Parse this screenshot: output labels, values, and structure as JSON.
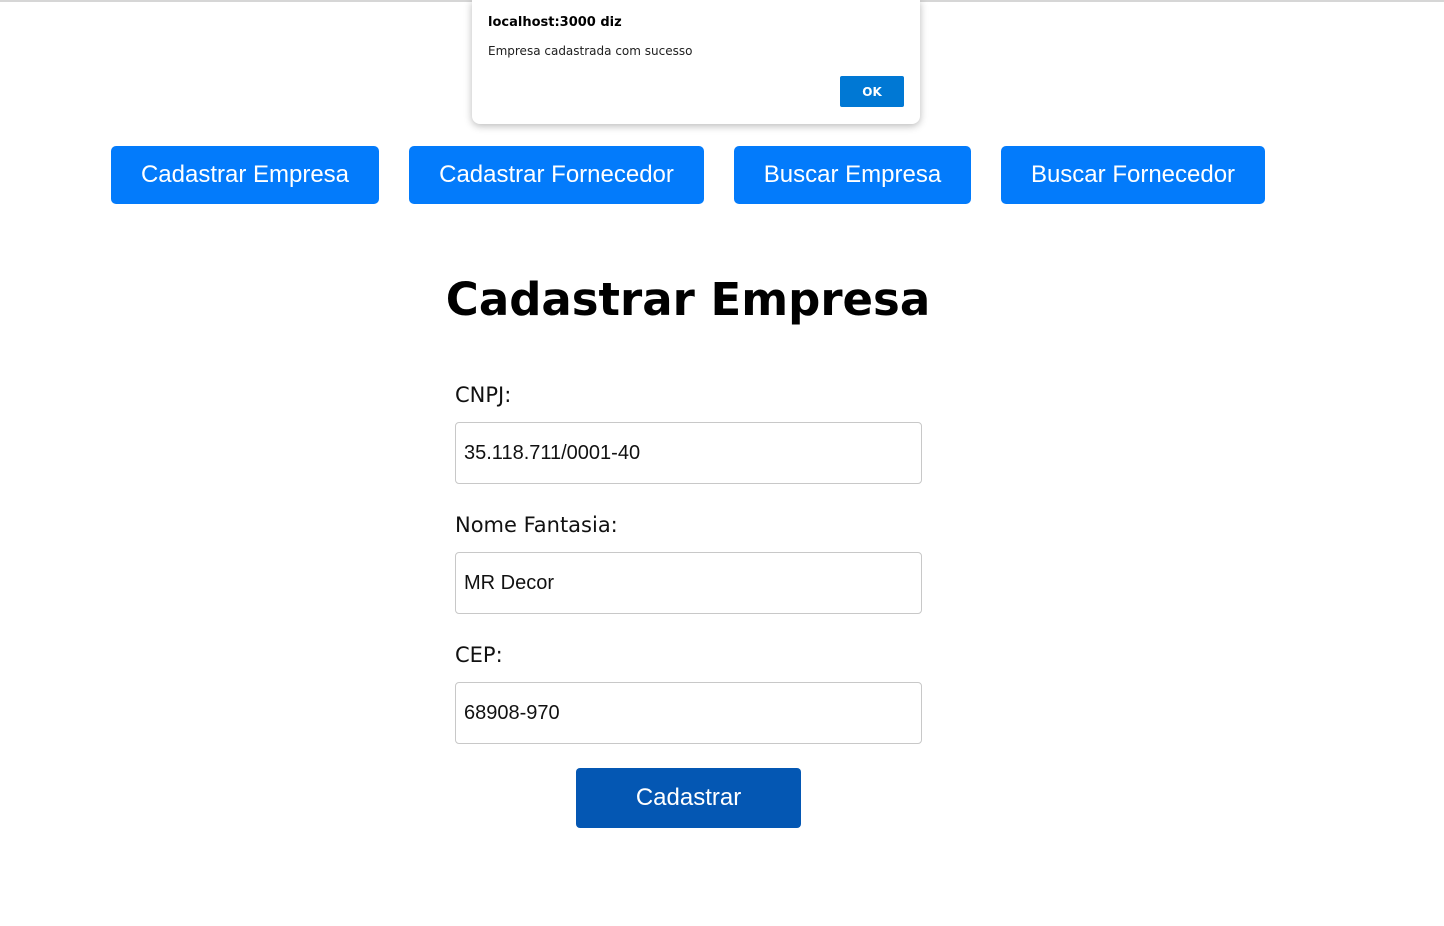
{
  "nav": {
    "items": [
      {
        "label": "Cadastrar Empresa"
      },
      {
        "label": "Cadastrar Fornecedor"
      },
      {
        "label": "Buscar Empresa"
      },
      {
        "label": "Buscar Fornecedor"
      }
    ]
  },
  "form": {
    "title": "Cadastrar Empresa",
    "fields": [
      {
        "label": "CNPJ:",
        "value": "35.118.711/0001-40"
      },
      {
        "label": "Nome Fantasia:",
        "value": "MR Decor"
      },
      {
        "label": "CEP:",
        "value": "68908-970"
      }
    ],
    "submit_label": "Cadastrar"
  },
  "dialog": {
    "title": "localhost:3000 diz",
    "message": "Empresa cadastrada com sucesso",
    "ok_label": "OK"
  },
  "colors": {
    "nav_button": "#037bfb",
    "submit_button": "#0457b3",
    "dialog_ok": "#0078d4"
  }
}
